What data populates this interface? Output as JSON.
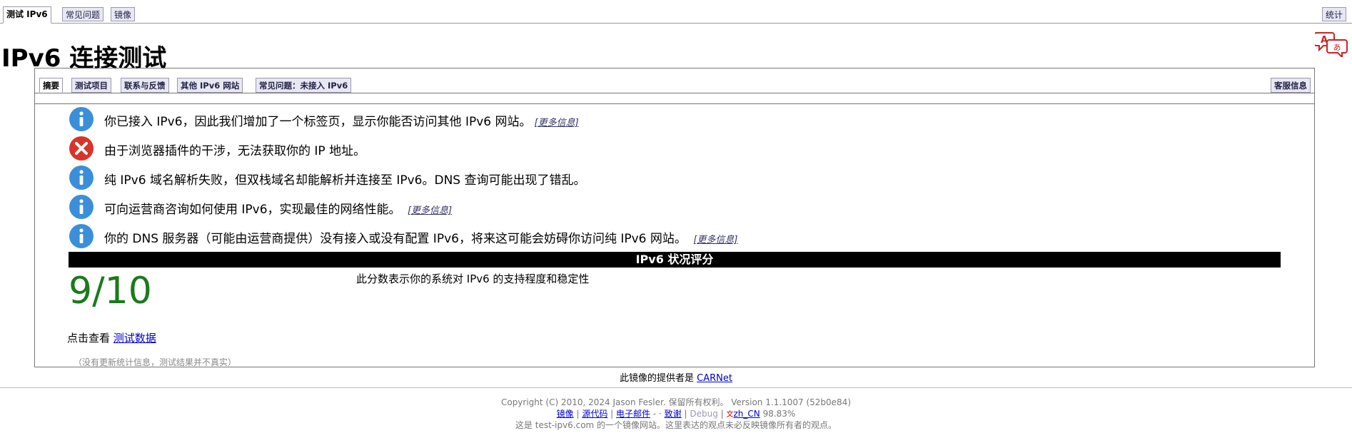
{
  "top_tabs": {
    "test": "测试 IPv6",
    "faq": "常见问题",
    "mirrors": "镜像",
    "stats": "统计"
  },
  "title": "IPv6 连接测试",
  "sub_tabs": {
    "summary": "摘要",
    "tests": "测试项目",
    "contact": "联系与反馈",
    "other_sites": "其他 IPv6 网站",
    "faq_no_ipv6": "常见问题：未接入 IPv6",
    "help_info": "客服信息"
  },
  "messages": [
    {
      "type": "info",
      "text": "你已接入 IPv6，因此我们增加了一个标签页，显示你能否访问其他 IPv6 网站。",
      "more": "[更多信息]"
    },
    {
      "type": "error",
      "text": "由于浏览器插件的干涉，无法获取你的 IP 地址。"
    },
    {
      "type": "info",
      "text": "纯 IPv6 域名解析失败，但双栈域名却能解析并连接至 IPv6。DNS 查询可能出现了错乱。"
    },
    {
      "type": "info",
      "text": "可向运营商咨询如何使用 IPv6，实现最佳的网络性能。",
      "more": "[更多信息]"
    },
    {
      "type": "info",
      "text": "你的 DNS 服务器（可能由运营商提供）没有接入或没有配置 IPv6，将来这可能会妨碍你访问纯 IPv6 网站。",
      "more": "[更多信息]"
    }
  ],
  "score": {
    "header": "IPv6 状况评分",
    "value": "9/10",
    "description": "此分数表示你的系统对 IPv6 的支持程度和稳定性"
  },
  "view": {
    "prefix": "点击查看",
    "link": "测试数据"
  },
  "stale_note": "（没有更新统计信息，测试结果并不真实）",
  "mirror": {
    "prefix": "此镜像的提供者是",
    "provider": "CARNet"
  },
  "footer": {
    "copyright": "Copyright (C) 2010, 2024 Jason Fesler. 保留所有权利。 Version 1.1.1007 (52b0e84)",
    "links": {
      "mirrors": "镜像",
      "source": "源代码",
      "email": "电子邮件",
      "dash": "-",
      "thanks": "致谢",
      "debug": "Debug",
      "locale": "zh_CN",
      "percent": "98.83%"
    },
    "note": "这是 test-ipv6.com 的一个镜像网站。这里表达的观点未必反映镜像所有者的观点。"
  },
  "colors": {
    "score_green": "#1b7a1b",
    "info_blue": "#3b8fd9",
    "error_red": "#d9342b"
  }
}
